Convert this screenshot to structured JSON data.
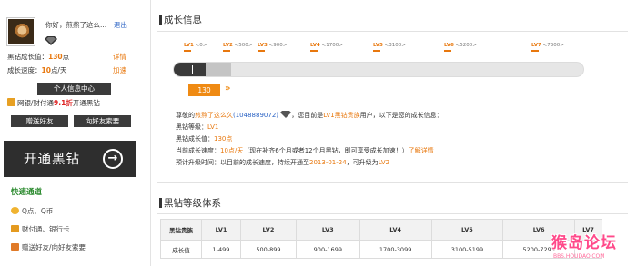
{
  "user": {
    "greeting": "你好，煎熬了这么...",
    "logout": "退出",
    "score_label": "黑钻成长值：",
    "score_value": "130",
    "score_unit": "点",
    "score_link": "详情",
    "speed_label": "成长速度：",
    "speed_value": "10",
    "speed_unit": "点/天",
    "speed_link": "加速",
    "center_button": "个人信息中心",
    "bank_prefix": "网银/财付通",
    "bank_highlight": "9.1折",
    "bank_suffix": "开通黑钻",
    "gift_button": "赠送好友",
    "ask_button": "向好友索要"
  },
  "banner": {
    "label": "开通黑钻",
    "arrow": "→"
  },
  "quick": {
    "title": "快速通道",
    "items": [
      {
        "label": "Q点、Q币",
        "icon": "coin-icon"
      },
      {
        "label": "财付通、银行卡",
        "icon": "key-icon"
      },
      {
        "label": "赠送好友/向好友索要",
        "icon": "gift-icon"
      }
    ]
  },
  "growth": {
    "title": "成长信息",
    "levels": [
      {
        "tag": "LV1",
        "range": "<0>"
      },
      {
        "tag": "LV2",
        "range": "<500>"
      },
      {
        "tag": "LV3",
        "range": "<900>"
      },
      {
        "tag": "LV4",
        "range": "<1700>"
      },
      {
        "tag": "LV5",
        "range": "<3100>"
      },
      {
        "tag": "LV6",
        "range": "<5200>"
      },
      {
        "tag": "LV7",
        "range": "<7300>"
      }
    ],
    "current_value": "130",
    "arrow": "»",
    "progress_fraction": 0.14,
    "line1_a": "尊敬的",
    "line1_name": "煎熬了这么久",
    "line1_id": "(1048889072)",
    "line1_b": "，您目前是",
    "line1_level": "LV1黑钻贵族",
    "line1_c": "用户，以下是您的成长信息：",
    "line2_label": "黑钻等级：",
    "line2_value": "LV1",
    "line3_label": "黑钻成长值：",
    "line3_value": "130点",
    "line4_label": "当前成长速度：",
    "line4_value": "10点/天",
    "line4_text": "（现在补齐6个月或者12个月黑钻，即可享受成长加速！）",
    "line4_link": "了解详情",
    "line5_label": "预计升级时间：以目前的成长速度，持续开通至",
    "line5_date": "2013-01-24",
    "line5_mid": "，可升级为",
    "line5_level": "LV2"
  },
  "system": {
    "title": "黑钻等级体系",
    "header": [
      "黑钻贵族",
      "LV1",
      "LV2",
      "LV3",
      "LV4",
      "LV5",
      "LV6",
      "LV7"
    ],
    "row": [
      "成长值",
      "1-499",
      "500-899",
      "900-1699",
      "1700-3099",
      "3100-5199",
      "5200-7299",
      ""
    ]
  },
  "watermark": {
    "big": "猴岛论坛",
    "small": "BBS.HOUDAO.COM"
  },
  "colors": {
    "accent": "#e8780e",
    "link": "#2b63c4",
    "dark": "#2e2e2e"
  }
}
